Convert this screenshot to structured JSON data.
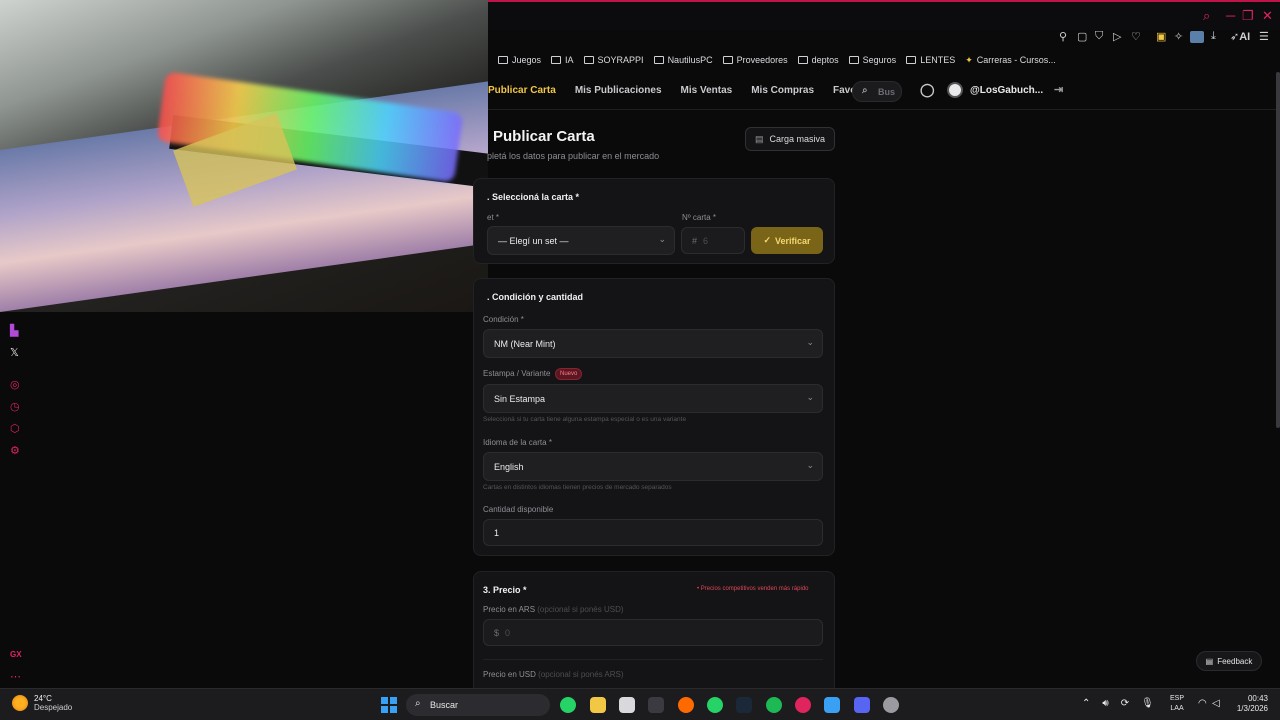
{
  "bookmarks": [
    "Juegos",
    "IA",
    "SOYRAPPI",
    "NautilusPC",
    "Proveedores",
    "deptos",
    "Seguros",
    "LENTES",
    "Carreras - Cursos..."
  ],
  "toolbar": {
    "ai_label": "AI"
  },
  "nav": {
    "items": [
      "Publicar Carta",
      "Mis Publicaciones",
      "Mis Ventas",
      "Mis Compras",
      "Favoritos"
    ],
    "search_placeholder": "Bus",
    "username": "@LosGabuch..."
  },
  "page": {
    "title": "Publicar Carta",
    "subtitle": "pletá los datos para publicar en el mercado",
    "bulk_button": "Carga masiva"
  },
  "section1": {
    "title": ". Seleccioná la carta *",
    "set_label": "et *",
    "set_value": "— Elegí un set —",
    "number_label": "Nº carta *",
    "number_prefix": "#",
    "number_placeholder": "6",
    "verify_button": "Verificar"
  },
  "section2": {
    "title": ". Condición y cantidad",
    "condition_label": "Condición *",
    "condition_value": "NM (Near Mint)",
    "stamp_label": "Estampa / Variante",
    "stamp_badge": "Nuevo",
    "stamp_value": "Sin Estampa",
    "stamp_hint": "Seleccioná si tu carta tiene alguna estampa especial o es una variante",
    "language_label": "Idioma de la carta *",
    "language_value": "English",
    "language_hint": "Cartas en distintos idiomas tienen precios de mercado separados",
    "quantity_label": "Cantidad disponible",
    "quantity_value": "1"
  },
  "section3": {
    "title": "3. Precio *",
    "tip": "• Precios competitivos venden más rápido",
    "ars_label": "Precio en ARS",
    "ars_hint": "(opcional si ponés USD)",
    "ars_prefix": "$",
    "ars_placeholder": "0",
    "usd_label": "Precio en USD",
    "usd_hint": "(opcional si ponés ARS)"
  },
  "feedback": "Feedback",
  "taskbar": {
    "temperature": "24°C",
    "weather": "Despejado",
    "search": "Buscar",
    "lang_top": "ESP",
    "lang_bottom": "LAA",
    "time": "00:43",
    "date": "1/3/2026"
  },
  "colors": {
    "accent": "#f2c744",
    "opera": "#e0245e",
    "verify_bg": "#7a6418"
  }
}
